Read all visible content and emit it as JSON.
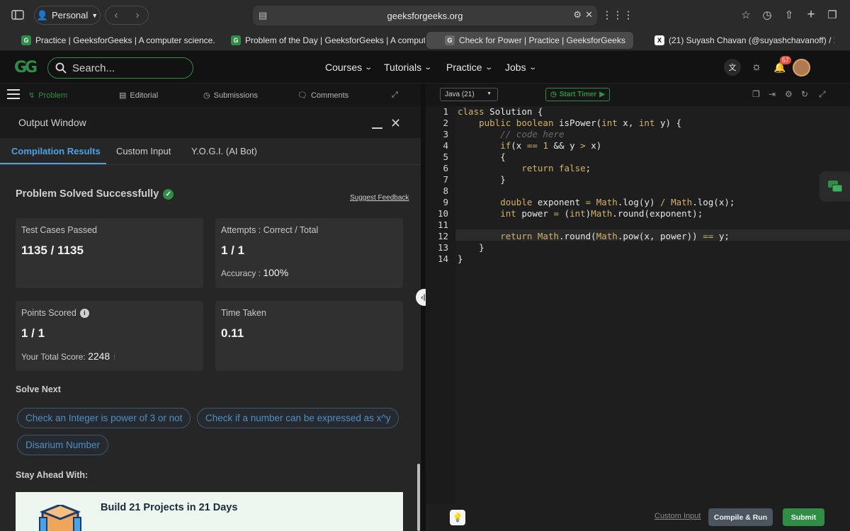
{
  "browser": {
    "profile": "Personal",
    "url": "geeksforgeeks.org",
    "tabs": [
      {
        "title": "Practice | GeeksforGeeks | A computer science..."
      },
      {
        "title": "Problem of the Day | GeeksforGeeks | A comput..."
      },
      {
        "title": "Check for Power | Practice | GeeksforGeeks"
      },
      {
        "title": "(21) Suyash Chavan (@suyashchavanoff) / X"
      }
    ]
  },
  "header": {
    "search_placeholder": "Search...",
    "nav": [
      "Courses",
      "Tutorials",
      "Practice",
      "Jobs"
    ],
    "notification_count": "57"
  },
  "problem_toolbar": {
    "tabs": [
      "Problem",
      "Editorial",
      "Submissions",
      "Comments"
    ]
  },
  "output": {
    "title": "Output Window",
    "tabs": [
      "Compilation Results",
      "Custom Input",
      "Y.O.G.I. (AI Bot)"
    ],
    "status": "Problem Solved Successfully",
    "suggest_feedback": "Suggest Feedback",
    "cards": {
      "test_cases_label": "Test Cases Passed",
      "test_cases_value": "1135 / 1135",
      "attempts_label": "Attempts : Correct / Total",
      "attempts_value": "1 / 1",
      "accuracy_label": "Accuracy :",
      "accuracy_value": "100%",
      "points_label": "Points Scored",
      "points_value": "1 / 1",
      "total_score_label": "Your Total Score:",
      "total_score_value": "2248",
      "time_label": "Time Taken",
      "time_value": "0.11"
    },
    "solve_next_heading": "Solve Next",
    "solve_next": [
      "Check an Integer is power of 3 or not",
      "Check if a number can be expressed as x^y",
      "Disarium Number"
    ],
    "stay_ahead_heading": "Stay Ahead With:",
    "banner_title": "Build 21 Projects in 21 Days"
  },
  "editor": {
    "language": "Java (21)",
    "start_timer": "Start Timer",
    "line_numbers": [
      "1",
      "2",
      "3",
      "4",
      "5",
      "6",
      "7",
      "8",
      "9",
      "10",
      "11",
      "12",
      "13",
      "14"
    ],
    "custom_input": "Custom Input",
    "compile_run": "Compile & Run",
    "submit": "Submit"
  }
}
